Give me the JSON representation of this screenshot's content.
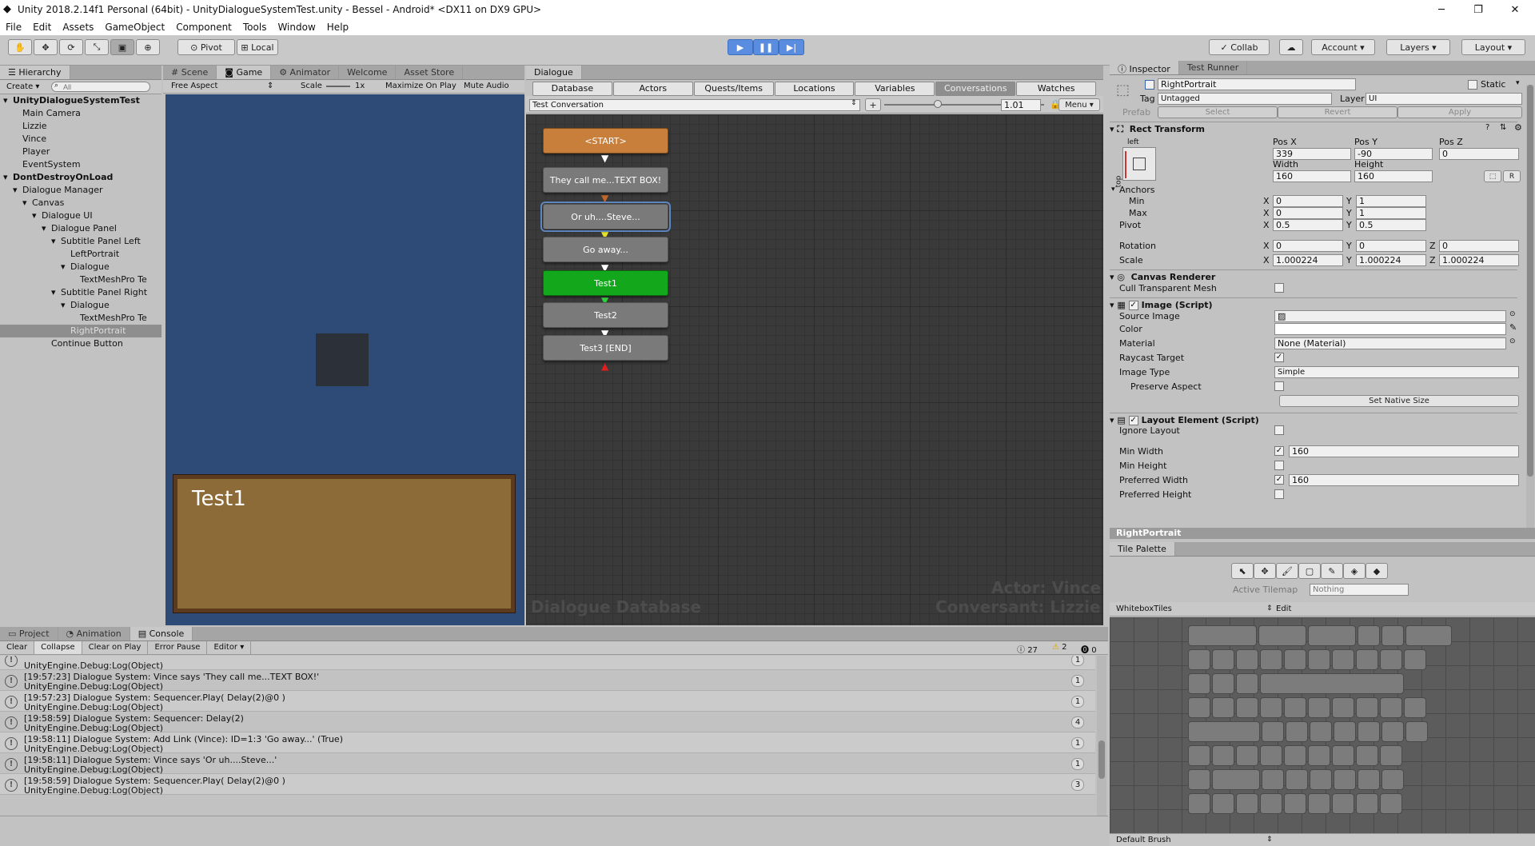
{
  "window": {
    "title": "Unity 2018.2.14f1 Personal (64bit) - UnityDialogueSystemTest.unity - Bessel - Android* <DX11 on DX9 GPU>",
    "minimize": "─",
    "maximize": "❐",
    "close": "✕"
  },
  "menu": [
    "File",
    "Edit",
    "Assets",
    "GameObject",
    "Component",
    "Tools",
    "Window",
    "Help"
  ],
  "toolbar": {
    "pivot": "Pivot",
    "local": "Local",
    "collab": "Collab",
    "account": "Account",
    "layers": "Layers",
    "layout": "Layout"
  },
  "hierarchy": {
    "tab": "Hierarchy",
    "create": "Create",
    "search_placeholder": "All",
    "items": [
      {
        "label": "UnityDialogueSystemTest",
        "indent": 0,
        "bold": true
      },
      {
        "label": "Main Camera",
        "indent": 1
      },
      {
        "label": "Lizzie",
        "indent": 1
      },
      {
        "label": "Vince",
        "indent": 1
      },
      {
        "label": "Player",
        "indent": 1
      },
      {
        "label": "EventSystem",
        "indent": 1
      },
      {
        "label": "DontDestroyOnLoad",
        "indent": 0,
        "bold": true
      },
      {
        "label": "Dialogue Manager",
        "indent": 1
      },
      {
        "label": "Canvas",
        "indent": 2
      },
      {
        "label": "Dialogue UI",
        "indent": 3
      },
      {
        "label": "Dialogue Panel",
        "indent": 4
      },
      {
        "label": "Subtitle Panel Left",
        "indent": 5
      },
      {
        "label": "LeftPortrait",
        "indent": 6
      },
      {
        "label": "Dialogue",
        "indent": 6
      },
      {
        "label": "TextMeshPro Te",
        "indent": 7
      },
      {
        "label": "Subtitle Panel Right",
        "indent": 5
      },
      {
        "label": "Dialogue",
        "indent": 6
      },
      {
        "label": "TextMeshPro Te",
        "indent": 7
      },
      {
        "label": "RightPortrait",
        "indent": 6,
        "selected": true
      },
      {
        "label": "Continue Button",
        "indent": 4
      }
    ]
  },
  "game_tabs": [
    "Scene",
    "Game",
    "Animator",
    "Welcome",
    "Asset Store"
  ],
  "game": {
    "aspect": "Free Aspect",
    "scale_label": "Scale",
    "scale_value": "1x",
    "maximize": "Maximize On Play",
    "mute": "Mute Audio",
    "subtitle": "Test1"
  },
  "dialogue": {
    "tab": "Dialogue",
    "tabs": [
      "Database",
      "Actors",
      "Quests/Items",
      "Locations",
      "Variables",
      "Conversations",
      "Watches"
    ],
    "conversation": "Test Conversation",
    "plus": "+",
    "zoom": "1.01",
    "menu": "Menu",
    "nodes": [
      "<START>",
      "They call me...TEXT BOX!",
      "Or uh....Steve...",
      "Go away...",
      "Test1",
      "Test2",
      "Test3 [END]"
    ],
    "watermark_left": "Dialogue Database",
    "watermark_actor": "Actor: Vince",
    "watermark_conversant": "Conversant: Lizzie"
  },
  "inspector": {
    "tab": "Inspector",
    "tab2": "Test Runner",
    "name": "RightPortrait",
    "static": "Static",
    "tag_label": "Tag",
    "tag": "Untagged",
    "layer_label": "Layer",
    "layer": "UI",
    "prefab": "Prefab",
    "select": "Select",
    "revert": "Revert",
    "apply": "Apply",
    "rect": {
      "title": "Rect Transform",
      "anchor_h": "left",
      "anchor_v": "top",
      "posx_label": "Pos X",
      "posy_label": "Pos Y",
      "posz_label": "Pos Z",
      "posx": "339",
      "posy": "-90",
      "posz": "0",
      "width_label": "Width",
      "height_label": "Height",
      "width": "160",
      "height": "160",
      "r": "R",
      "anchors": "Anchors",
      "min": "Min",
      "max": "Max",
      "min_x": "0",
      "min_y": "1",
      "max_x": "0",
      "max_y": "1",
      "pivot": "Pivot",
      "pivot_x": "0.5",
      "pivot_y": "0.5",
      "rotation": "Rotation",
      "rot_x": "0",
      "rot_y": "0",
      "rot_z": "0",
      "scale": "Scale",
      "sc_x": "1.000224",
      "sc_y": "1.000224",
      "sc_z": "1.000224",
      "x": "X",
      "y": "Y",
      "z": "Z"
    },
    "canvas_renderer": {
      "title": "Canvas Renderer",
      "cull": "Cull Transparent Mesh"
    },
    "image": {
      "title": "Image (Script)",
      "source": "Source Image",
      "color": "Color",
      "material": "Material",
      "material_val": "None (Material)",
      "raycast": "Raycast Target",
      "type": "Image Type",
      "type_val": "Simple",
      "preserve": "Preserve Aspect",
      "native": "Set Native Size"
    },
    "layout": {
      "title": "Layout Element (Script)",
      "ignore": "Ignore Layout",
      "min_w": "Min Width",
      "min_w_val": "160",
      "min_h": "Min Height",
      "pref_w": "Preferred Width",
      "pref_w_val": "160",
      "pref_h": "Preferred Height"
    },
    "footer": "RightPortrait"
  },
  "tile_palette": {
    "tab": "Tile Palette",
    "active_label": "Active Tilemap",
    "active_val": "Nothing",
    "palette": "WhiteboxTiles",
    "edit": "Edit",
    "brush": "Default Brush"
  },
  "console": {
    "tabs": [
      "Project",
      "Animation",
      "Console"
    ],
    "buttons": [
      "Clear",
      "Collapse",
      "Clear on Play",
      "Error Pause",
      "Editor"
    ],
    "counts": {
      "info": "27",
      "warn": "2",
      "error": "0"
    },
    "rows": [
      {
        "t1": "",
        "t2": "UnityEngine.Debug:Log(Object)",
        "n": "1"
      },
      {
        "t1": "[19:57:23] Dialogue System: Vince says 'They call me...TEXT BOX!'",
        "t2": "UnityEngine.Debug:Log(Object)",
        "n": "1"
      },
      {
        "t1": "[19:57:23] Dialogue System: Sequencer.Play( Delay(2)@0 )",
        "t2": "UnityEngine.Debug:Log(Object)",
        "n": "1"
      },
      {
        "t1": "[19:58:59] Dialogue System: Sequencer: Delay(2)",
        "t2": "UnityEngine.Debug:Log(Object)",
        "n": "4"
      },
      {
        "t1": "[19:58:11] Dialogue System: Add Link (Vince): ID=1:3 'Go away...' (True)",
        "t2": "UnityEngine.Debug:Log(Object)",
        "n": "1"
      },
      {
        "t1": "[19:58:11] Dialogue System: Vince says 'Or uh....Steve...'",
        "t2": "UnityEngine.Debug:Log(Object)",
        "n": "1"
      },
      {
        "t1": "[19:58:59] Dialogue System: Sequencer.Play( Delay(2)@0 )",
        "t2": "UnityEngine.Debug:Log(Object)",
        "n": "3"
      }
    ]
  }
}
